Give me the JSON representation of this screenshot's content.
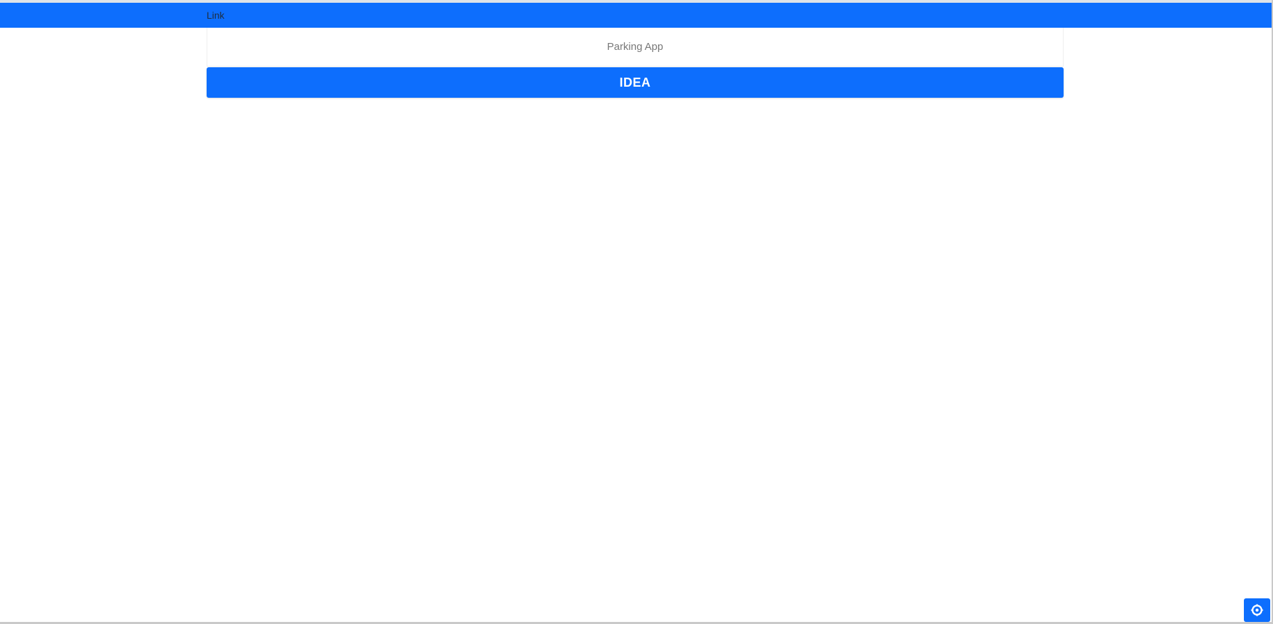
{
  "navbar": {
    "brand_label": "Link"
  },
  "header": {
    "subtitle": "Parking App"
  },
  "main": {
    "idea_button_label": "IDEA"
  },
  "corner_button": {
    "icon": "gear-icon"
  },
  "colors": {
    "primary": "#0d6efd",
    "background": "#ffffff",
    "subtitle_text": "#777777"
  }
}
